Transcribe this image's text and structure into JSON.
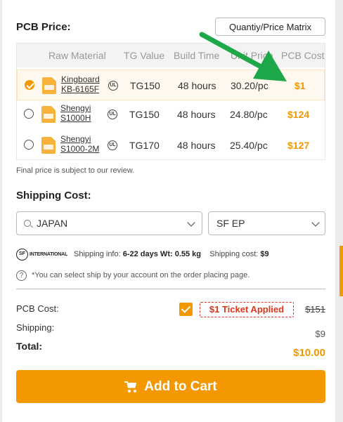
{
  "pcb_price": {
    "title": "PCB Price:",
    "matrix_button": "Quantiy/Price Matrix",
    "columns": [
      "Raw Material",
      "TG Value",
      "Build Time",
      "Unit Price",
      "PCB Cost"
    ],
    "rows": [
      {
        "material_line1": "Kingboard",
        "material_line2": "KB-6165F",
        "tg": "TG150",
        "build_time": "48 hours",
        "unit_price": "30.20/pc",
        "cost": "$1",
        "selected": true
      },
      {
        "material_line1": "Shengyi",
        "material_line2": "S1000H",
        "tg": "TG150",
        "build_time": "48 hours",
        "unit_price": "24.80/pc",
        "cost": "$124",
        "selected": false
      },
      {
        "material_line1": "Shengyi",
        "material_line2": "S1000-2M",
        "tg": "TG170",
        "build_time": "48 hours",
        "unit_price": "25.40/pc",
        "cost": "$127",
        "selected": false
      }
    ],
    "note": "Final price is subject to our review."
  },
  "shipping": {
    "title": "Shipping Cost:",
    "country": "JAPAN",
    "method": "SF EP",
    "carrier_logo_text": "SF",
    "carrier_word": "INTERNATIONAL",
    "info_label": "Shipping info:",
    "info_value": "6-22 days Wt: 0.55 kg",
    "cost_label": "Shipping cost:",
    "cost_value": "$9",
    "help_text": "*You can select ship by your account on the order placing page."
  },
  "summary": {
    "pcb_cost_label": "PCB Cost:",
    "ticket_text": "$1 Ticket Applied",
    "old_price": "$151",
    "shipping_label": "Shipping:",
    "shipping_value": "$9",
    "total_label": "Total:",
    "total_value": "$10.00"
  },
  "cart_button": "Add to Cart",
  "colors": {
    "accent": "#f39800",
    "ticket_red": "#e0341a",
    "annotation_arrow": "#1ea84a"
  },
  "icons": [
    "check-icon",
    "file-icon",
    "ul-cert-icon",
    "search-icon",
    "chevron-down-icon",
    "help-icon",
    "cart-icon",
    "annotation-arrow"
  ]
}
